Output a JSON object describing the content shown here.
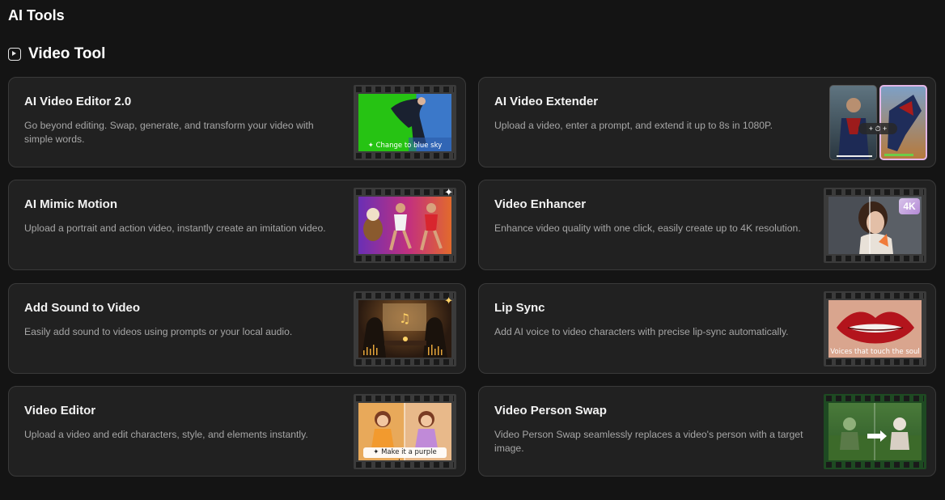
{
  "page": {
    "title": "AI Tools"
  },
  "section": {
    "title": "Video Tool",
    "icon": "video-frame-icon"
  },
  "cards": [
    {
      "title": "AI Video Editor 2.0",
      "desc": "Go beyond editing. Swap, generate, and transform your video with simple words.",
      "caption": "✦ Change to blue sky"
    },
    {
      "title": "AI Video Extender",
      "desc": "Upload a video, enter a prompt, and extend it up to 8s in 1080P.",
      "caption": "+ ⏱ +"
    },
    {
      "title": "AI Mimic Motion",
      "desc": "Upload a portrait and action video, instantly create an imitation video.",
      "caption": ""
    },
    {
      "title": "Video Enhancer",
      "desc": "Enhance video quality with one click, easily create up to 4K resolution.",
      "caption": "4K"
    },
    {
      "title": "Add Sound to Video",
      "desc": "Easily add sound to videos using prompts or your local audio.",
      "caption": ""
    },
    {
      "title": "Lip Sync",
      "desc": "Add AI voice to video characters with precise lip-sync automatically.",
      "caption": "Voices that touch the soul"
    },
    {
      "title": "Video Editor",
      "desc": "Upload a video and edit characters, style, and elements instantly.",
      "caption": "✦ Make it a purple dress"
    },
    {
      "title": "Video Person Swap",
      "desc": "Video Person Swap seamlessly replaces a video's person with a target image.",
      "caption": ""
    }
  ],
  "colors": {
    "background": "#141414",
    "card": "#212121",
    "card_border": "#3a3a3a",
    "text_muted": "#a6a6a6"
  }
}
